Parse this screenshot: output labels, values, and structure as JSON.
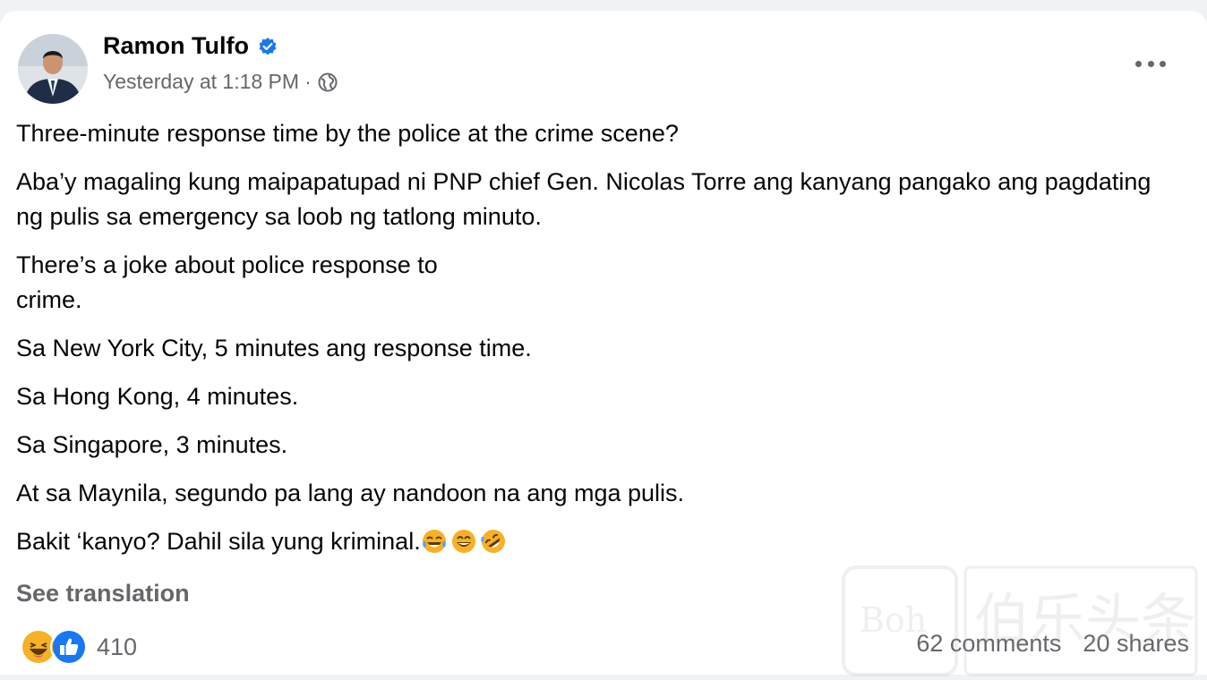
{
  "post": {
    "author": "Ramon Tulfo",
    "timestamp": "Yesterday at 1:18 PM",
    "separator": "·",
    "audience_icon": "globe-icon",
    "verified_icon": "verified-badge-icon",
    "more_icon": "more-options-icon",
    "paragraphs": [
      "Three-minute response time by the police at the crime scene?",
      "Aba’y magaling kung maipapatupad ni PNP chief Gen. Nicolas Torre ang kanyang pangako ang pagdating ng pulis sa emergency sa loob ng tatlong minuto.",
      "There’s a joke about police response to crime.",
      "Sa New York City, 5 minutes ang response time.",
      "Sa Hong Kong, 4 minutes.",
      "Sa Singapore, 3 minutes.",
      "At sa Maynila, segundo pa lang ay nandoon na ang mga pulis."
    ],
    "last_paragraph": "Bakit ‘kanyo? Dahil sila yung kriminal.",
    "last_paragraph_emojis": [
      "tears-of-joy-emoji",
      "grinning-emoji",
      "rolling-laughing-emoji"
    ],
    "see_translation": "See translation"
  },
  "engagement": {
    "reaction_icons": [
      "haha-reaction-icon",
      "like-reaction-icon"
    ],
    "reaction_count": "410",
    "comments": "62 comments",
    "shares": "20 shares"
  },
  "colors": {
    "text": "#050505",
    "secondary": "#65676b",
    "brand_blue": "#1877f2",
    "haha_yellow": "#f7b125",
    "background": "#f0f2f5"
  }
}
